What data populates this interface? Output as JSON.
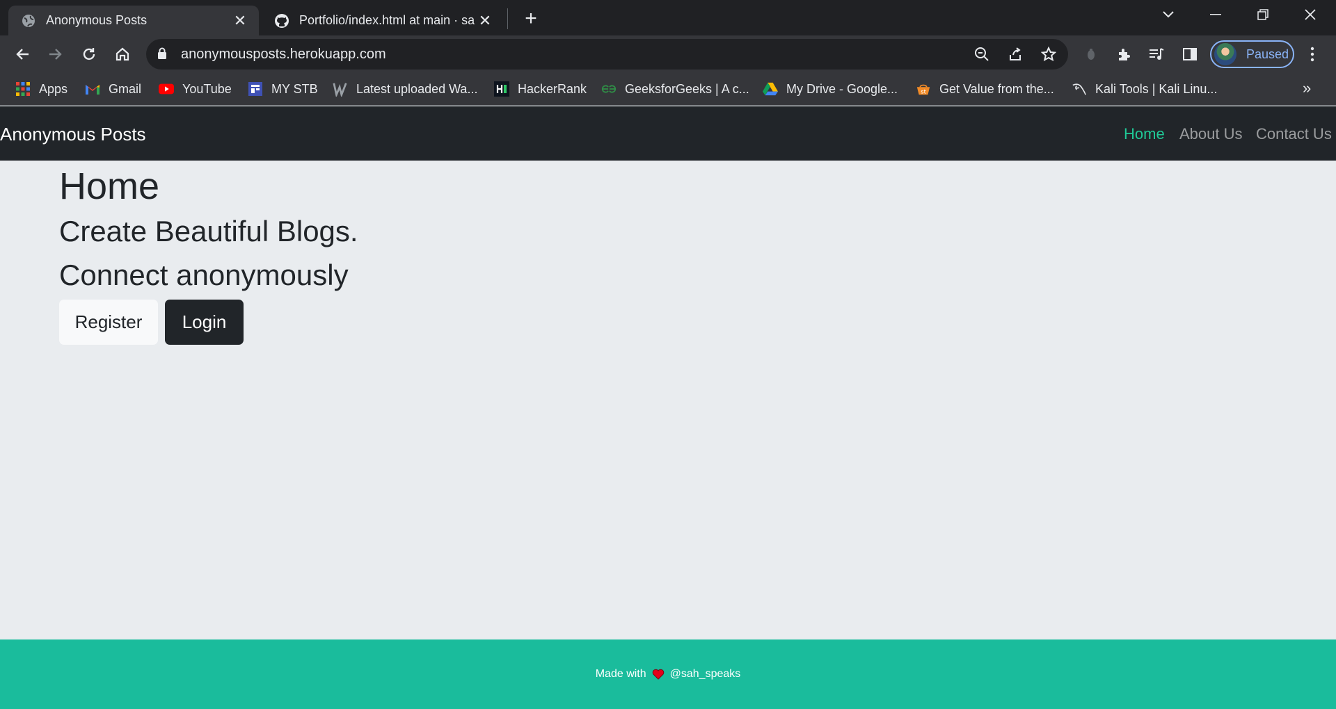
{
  "browser": {
    "tabs": [
      {
        "title": "Anonymous Posts",
        "icon": "globe-icon",
        "active": true
      },
      {
        "title": "Portfolio/index.html at main · sah",
        "icon": "github-icon",
        "active": false
      }
    ],
    "url": "anonymousposts.herokuapp.com",
    "profile_label": "Paused",
    "bookmarks": [
      {
        "label": "Apps",
        "icon": "apps-grid-icon"
      },
      {
        "label": "Gmail",
        "icon": "gmail-icon"
      },
      {
        "label": "YouTube",
        "icon": "youtube-icon"
      },
      {
        "label": "MY STB",
        "icon": "stb-icon"
      },
      {
        "label": "Latest uploaded Wa...",
        "icon": "w-icon"
      },
      {
        "label": "HackerRank",
        "icon": "hackerrank-icon"
      },
      {
        "label": "GeeksforGeeks | A c...",
        "icon": "geeksforgeeks-icon"
      },
      {
        "label": "My Drive - Google...",
        "icon": "google-drive-icon"
      },
      {
        "label": "Get Value from the...",
        "icon": "value-icon"
      },
      {
        "label": "Kali Tools | Kali Linu...",
        "icon": "kali-icon"
      }
    ],
    "bookmarks_more": "»"
  },
  "page": {
    "brand": "Anonymous Posts",
    "nav": [
      {
        "label": "Home",
        "active": true
      },
      {
        "label": "About Us",
        "active": false
      },
      {
        "label": "Contact Us",
        "active": false
      }
    ],
    "heading": "Home",
    "subheading_1": "Create Beautiful Blogs.",
    "subheading_2": "Connect anonymously",
    "register_label": "Register",
    "login_label": "Login",
    "footer": {
      "prefix": "Made with",
      "handle": "@sah_speaks",
      "icon": "heart-icon"
    }
  },
  "colors": {
    "navbar": "#212529",
    "page_bg": "#e9ecef",
    "active_link": "#20c997",
    "footer": "#1abc9c"
  }
}
